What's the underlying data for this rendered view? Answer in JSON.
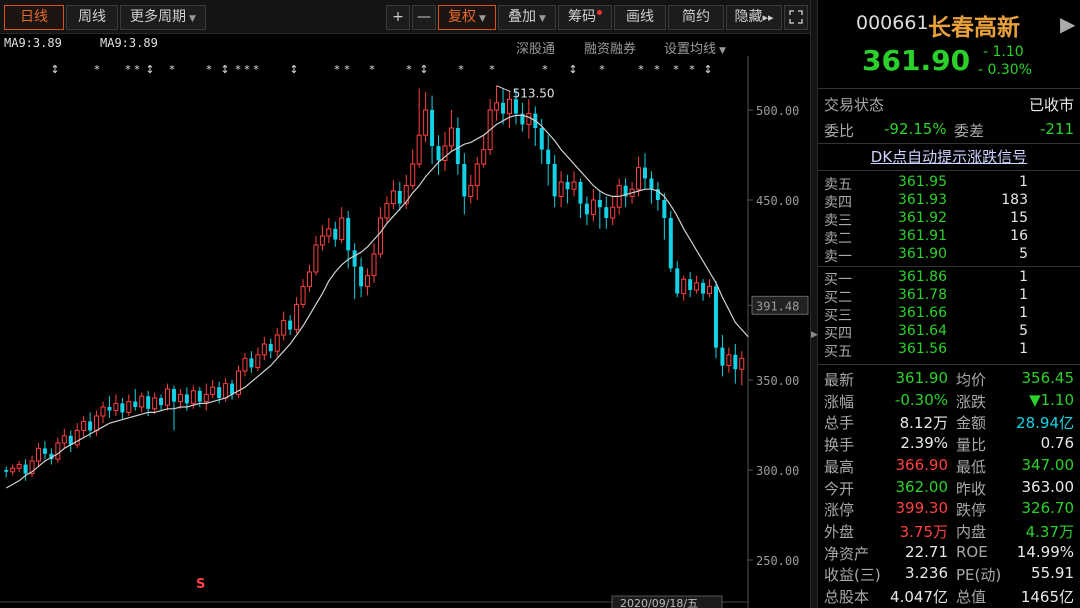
{
  "toolbar": {
    "period_buttons": [
      "日线",
      "周线",
      "更多周期"
    ],
    "zoom_in": "+",
    "zoom_out": "—",
    "adjust": "复权",
    "overlay": "叠加",
    "chips": "筹码",
    "draw": "画线",
    "simple": "简约",
    "hide": "隐藏",
    "hide_arrows": "▸▸",
    "fullscreen_icon": "fullscreen-icon"
  },
  "chart_header": {
    "ma_labels": [
      "MA9:3.89",
      "MA9:3.89"
    ],
    "links": [
      "深股通",
      "融资融券",
      "设置均线"
    ]
  },
  "chart_data": {
    "type": "candlestick",
    "x_date_label": "2020/09/18/五",
    "y_ticks": [
      500.0,
      450.0,
      391.48,
      350.0,
      300.0,
      250.0
    ],
    "current_price_label": "391.48",
    "max_annotation": "513.50",
    "ylim": [
      230,
      530
    ],
    "ma_color": "#d0d0d0",
    "up_color": "#ff4040",
    "down_color": "#14d2e6",
    "s_marker": "S",
    "candles": [
      [
        300,
        299,
        302,
        296
      ],
      [
        299,
        301,
        303,
        297
      ],
      [
        301,
        303,
        305,
        299
      ],
      [
        303,
        298,
        306,
        294
      ],
      [
        298,
        305,
        308,
        296
      ],
      [
        305,
        312,
        315,
        302
      ],
      [
        312,
        309,
        316,
        306
      ],
      [
        309,
        306,
        312,
        303
      ],
      [
        306,
        315,
        318,
        304
      ],
      [
        315,
        319,
        323,
        312
      ],
      [
        319,
        314,
        322,
        310
      ],
      [
        314,
        322,
        326,
        312
      ],
      [
        322,
        327,
        330,
        318
      ],
      [
        327,
        322,
        332,
        318
      ],
      [
        322,
        330,
        333,
        319
      ],
      [
        330,
        335,
        338,
        326
      ],
      [
        335,
        333,
        341,
        329
      ],
      [
        333,
        337,
        342,
        330
      ],
      [
        337,
        332,
        340,
        328
      ],
      [
        332,
        338,
        342,
        330
      ],
      [
        338,
        335,
        345,
        333
      ],
      [
        335,
        341,
        343,
        332
      ],
      [
        341,
        334,
        344,
        330
      ],
      [
        334,
        340,
        343,
        331
      ],
      [
        340,
        336,
        342,
        333
      ],
      [
        336,
        345,
        348,
        333
      ],
      [
        345,
        338,
        347,
        322
      ],
      [
        338,
        342,
        345,
        334
      ],
      [
        342,
        337,
        346,
        333
      ],
      [
        337,
        344,
        347,
        334
      ],
      [
        344,
        338,
        346,
        335
      ],
      [
        338,
        342,
        348,
        333
      ],
      [
        342,
        346,
        350,
        340
      ],
      [
        346,
        340,
        349,
        337
      ],
      [
        340,
        348,
        351,
        338
      ],
      [
        348,
        342,
        350,
        339
      ],
      [
        342,
        355,
        358,
        340
      ],
      [
        355,
        362,
        365,
        352
      ],
      [
        362,
        357,
        366,
        354
      ],
      [
        357,
        364,
        368,
        355
      ],
      [
        364,
        370,
        374,
        361
      ],
      [
        370,
        366,
        373,
        362
      ],
      [
        366,
        375,
        379,
        363
      ],
      [
        375,
        383,
        388,
        372
      ],
      [
        383,
        378,
        386,
        375
      ],
      [
        378,
        392,
        396,
        376
      ],
      [
        392,
        402,
        406,
        390
      ],
      [
        402,
        410,
        414,
        399
      ],
      [
        410,
        425,
        430,
        408
      ],
      [
        425,
        430,
        436,
        422
      ],
      [
        430,
        434,
        440,
        426
      ],
      [
        434,
        428,
        438,
        424
      ],
      [
        428,
        440,
        446,
        426
      ],
      [
        440,
        422,
        444,
        412
      ],
      [
        422,
        413,
        426,
        395
      ],
      [
        413,
        402,
        418,
        396
      ],
      [
        402,
        408,
        412,
        397
      ],
      [
        408,
        420,
        426,
        404
      ],
      [
        420,
        440,
        446,
        418
      ],
      [
        440,
        448,
        452,
        437
      ],
      [
        448,
        455,
        461,
        445
      ],
      [
        455,
        448,
        460,
        444
      ],
      [
        448,
        458,
        464,
        445
      ],
      [
        458,
        470,
        478,
        456
      ],
      [
        470,
        486,
        512,
        468
      ],
      [
        486,
        500,
        510,
        482
      ],
      [
        500,
        480,
        508,
        470
      ],
      [
        480,
        472,
        486,
        464
      ],
      [
        472,
        480,
        488,
        466
      ],
      [
        480,
        490,
        500,
        477
      ],
      [
        490,
        470,
        496,
        464
      ],
      [
        470,
        452,
        476,
        442
      ],
      [
        452,
        458,
        464,
        448
      ],
      [
        458,
        470,
        474,
        450
      ],
      [
        470,
        478,
        486,
        468
      ],
      [
        478,
        500,
        506,
        475
      ],
      [
        500,
        504,
        513.5,
        494
      ],
      [
        504,
        498,
        512,
        492
      ],
      [
        498,
        506,
        510,
        490
      ],
      [
        506,
        498,
        512,
        492
      ],
      [
        498,
        492,
        504,
        488
      ],
      [
        492,
        498,
        506,
        484
      ],
      [
        498,
        490,
        502,
        480
      ],
      [
        490,
        478,
        495,
        470
      ],
      [
        478,
        470,
        486,
        458
      ],
      [
        470,
        452,
        475,
        446
      ],
      [
        452,
        460,
        466,
        446
      ],
      [
        460,
        456,
        464,
        448
      ],
      [
        456,
        460,
        466,
        452
      ],
      [
        460,
        448,
        462,
        440
      ],
      [
        448,
        442,
        452,
        436
      ],
      [
        442,
        450,
        456,
        438
      ],
      [
        450,
        446,
        455,
        434
      ],
      [
        446,
        440,
        452,
        434
      ],
      [
        440,
        446,
        452,
        436
      ],
      [
        446,
        458,
        462,
        442
      ],
      [
        458,
        452,
        462,
        446
      ],
      [
        452,
        456,
        460,
        448
      ],
      [
        456,
        468,
        474,
        452
      ],
      [
        468,
        462,
        476,
        456
      ],
      [
        462,
        456,
        466,
        448
      ],
      [
        456,
        450,
        460,
        444
      ],
      [
        450,
        440,
        454,
        428
      ],
      [
        440,
        412,
        444,
        410
      ],
      [
        412,
        398,
        416,
        396
      ],
      [
        398,
        406,
        408,
        394
      ],
      [
        406,
        400,
        410,
        396
      ],
      [
        400,
        404,
        408,
        398
      ],
      [
        404,
        398,
        406,
        394
      ],
      [
        398,
        402,
        406,
        396
      ],
      [
        402,
        368,
        405,
        362
      ],
      [
        368,
        358,
        375,
        352
      ],
      [
        358,
        364,
        368,
        354
      ],
      [
        364,
        356,
        370,
        348
      ],
      [
        356,
        362,
        366,
        347
      ]
    ],
    "ma_values": [
      290,
      292,
      294,
      297,
      299,
      302,
      305,
      307,
      309,
      312,
      314,
      316,
      318,
      320,
      322,
      324,
      326,
      327,
      328,
      329,
      330,
      331,
      332,
      332,
      333,
      334,
      334,
      335,
      335,
      336,
      337,
      337,
      338,
      339,
      340,
      342,
      344,
      346,
      349,
      352,
      355,
      358,
      362,
      366,
      370,
      375,
      380,
      386,
      392,
      398,
      405,
      410,
      414,
      417,
      419,
      421,
      424,
      428,
      432,
      437,
      441,
      445,
      449,
      454,
      458,
      463,
      467,
      471,
      474,
      477,
      479,
      481,
      482,
      484,
      486,
      489,
      492,
      494,
      496,
      497,
      497,
      496,
      494,
      491,
      487,
      483,
      478,
      474,
      470,
      466,
      462,
      458,
      455,
      453,
      452,
      452,
      453,
      454,
      455,
      456,
      456,
      455,
      452,
      447,
      441,
      434,
      428,
      422,
      416,
      410,
      404,
      396,
      389,
      382,
      378,
      374
    ]
  },
  "quote": {
    "code": "000661",
    "name": "长春高新",
    "price": "361.90",
    "change": "- 1.10",
    "change_pct": "- 0.30%"
  },
  "status": {
    "state_label": "交易状态",
    "state_value": "已收市",
    "weibi_label": "委比",
    "weibi_value": "-92.15%",
    "weicha_label": "委差",
    "weicha_value": "-211"
  },
  "dk_signal": "DK点自动提示涨跌信号",
  "orderbook": {
    "asks": [
      {
        "label": "卖五",
        "price": "361.95",
        "vol": "1"
      },
      {
        "label": "卖四",
        "price": "361.93",
        "vol": "183"
      },
      {
        "label": "卖三",
        "price": "361.92",
        "vol": "15"
      },
      {
        "label": "卖二",
        "price": "361.91",
        "vol": "16"
      },
      {
        "label": "卖一",
        "price": "361.90",
        "vol": "5"
      }
    ],
    "bids": [
      {
        "label": "买一",
        "price": "361.86",
        "vol": "1"
      },
      {
        "label": "买二",
        "price": "361.78",
        "vol": "1"
      },
      {
        "label": "买三",
        "price": "361.66",
        "vol": "1"
      },
      {
        "label": "买四",
        "price": "361.64",
        "vol": "5"
      },
      {
        "label": "买五",
        "price": "361.56",
        "vol": "1"
      }
    ]
  },
  "stats": [
    {
      "l1": "最新",
      "v1": "361.90",
      "c1": "green",
      "l2": "均价",
      "v2": "356.45",
      "c2": "green"
    },
    {
      "l1": "涨幅",
      "v1": "-0.30%",
      "c1": "green",
      "l2": "涨跌",
      "v2": "▼1.10",
      "c2": "green"
    },
    {
      "l1": "总手",
      "v1": "8.12万",
      "c1": "white",
      "l2": "金额",
      "v2": "28.94亿",
      "c2": "cyan"
    },
    {
      "l1": "换手",
      "v1": "2.39%",
      "c1": "white",
      "l2": "量比",
      "v2": "0.76",
      "c2": "white"
    },
    {
      "l1": "最高",
      "v1": "366.90",
      "c1": "red",
      "l2": "最低",
      "v2": "347.00",
      "c2": "green"
    },
    {
      "l1": "今开",
      "v1": "362.00",
      "c1": "green",
      "l2": "昨收",
      "v2": "363.00",
      "c2": "white"
    },
    {
      "l1": "涨停",
      "v1": "399.30",
      "c1": "red",
      "l2": "跌停",
      "v2": "326.70",
      "c2": "green"
    },
    {
      "l1": "外盘",
      "v1": "3.75万",
      "c1": "red",
      "l2": "内盘",
      "v2": "4.37万",
      "c2": "green"
    },
    {
      "l1": "净资产",
      "v1": "22.71",
      "c1": "white",
      "l2": "ROE",
      "v2": "14.99%",
      "c2": "white"
    },
    {
      "l1": "收益(三)",
      "v1": "3.236",
      "c1": "white",
      "l2": "PE(动)",
      "v2": "55.91",
      "c2": "white"
    },
    {
      "l1": "总股本",
      "v1": "4.047亿",
      "c1": "white",
      "l2": "总值",
      "v2": "1465亿",
      "c2": "white"
    }
  ]
}
